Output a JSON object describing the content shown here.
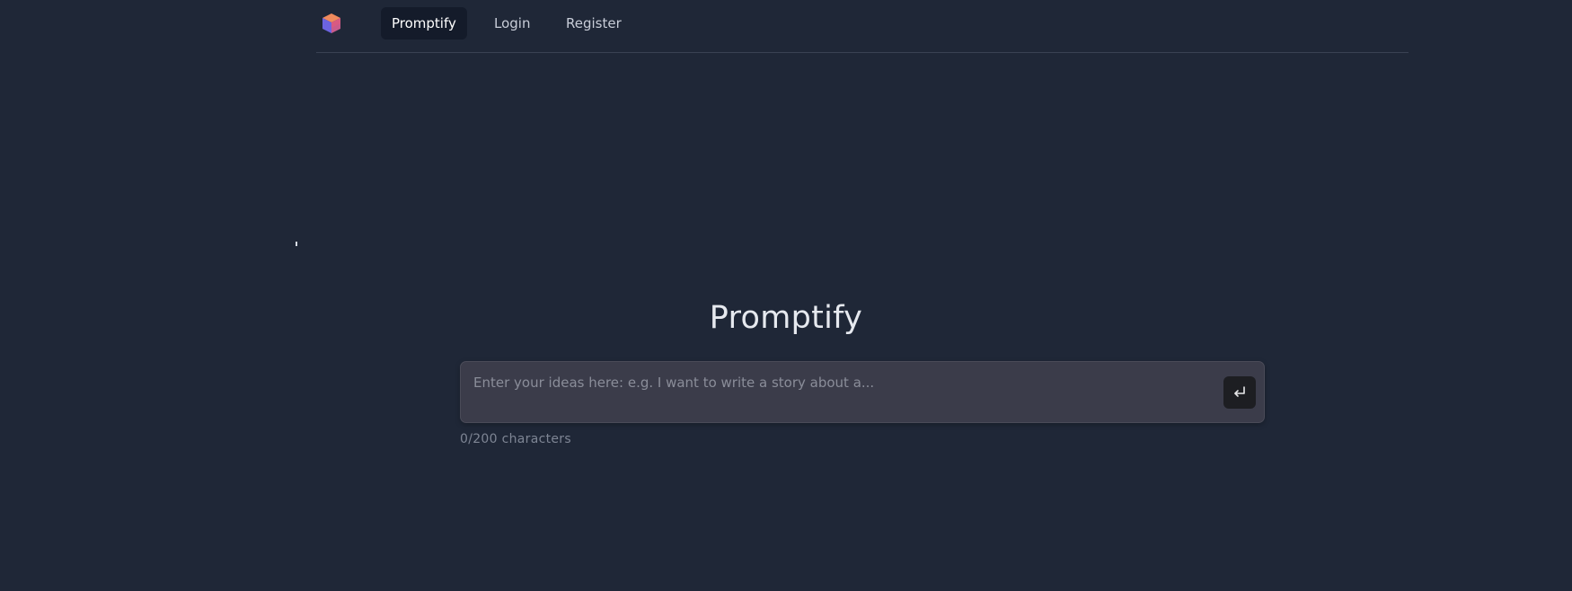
{
  "nav": {
    "logo_icon": "cube-logo-icon",
    "items": [
      {
        "label": "Promptify",
        "active": true
      },
      {
        "label": "Login",
        "active": false
      },
      {
        "label": "Register",
        "active": false
      }
    ]
  },
  "main": {
    "title": "Promptify",
    "input": {
      "value": "",
      "placeholder": "Enter your ideas here: e.g. I want to write a story about a..."
    },
    "submit_icon": "enter-return-icon",
    "char_count": "0/200 characters"
  },
  "colors": {
    "background": "#1f2737",
    "nav_active_bg": "#141b2a",
    "input_bg": "#3b3c4a",
    "submit_bg": "#1d1e22"
  }
}
